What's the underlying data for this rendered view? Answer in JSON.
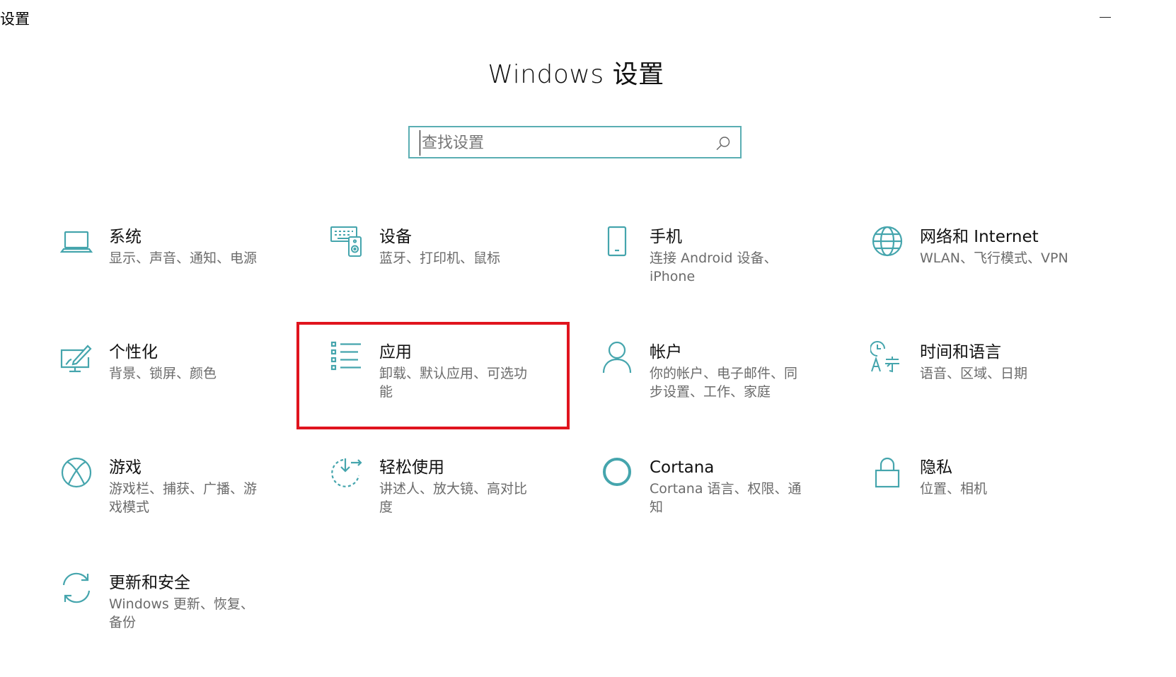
{
  "window": {
    "title": "设置",
    "minimize_label": "—"
  },
  "page": {
    "title": "Windows 设置"
  },
  "search": {
    "placeholder": "查找设置",
    "value": ""
  },
  "colors": {
    "accent": "#45a5ad",
    "highlight_frame": "#e0141e",
    "title_text": "#111111",
    "desc_text": "#6b6b6b"
  },
  "tiles": [
    {
      "title": "系统",
      "desc_lines": [
        "显示、声音、通知、电源"
      ],
      "icon": "laptop-icon"
    },
    {
      "title": "设备",
      "desc_lines": [
        "蓝牙、打印机、鼠标"
      ],
      "icon": "devices-icon"
    },
    {
      "title": "手机",
      "desc_lines": [
        "连接 Android 设备、",
        "iPhone"
      ],
      "icon": "phone-icon"
    },
    {
      "title": "网络和 Internet",
      "desc_lines": [
        "WLAN、飞行模式、VPN"
      ],
      "icon": "globe-icon"
    },
    {
      "title": "个性化",
      "desc_lines": [
        "背景、锁屏、颜色"
      ],
      "icon": "personalization-icon"
    },
    {
      "title": "应用",
      "desc_lines": [
        "卸载、默认应用、可选功",
        "能"
      ],
      "icon": "apps-list-icon"
    },
    {
      "title": "帐户",
      "desc_lines": [
        "你的帐户、电子邮件、同",
        "步设置、工作、家庭"
      ],
      "icon": "person-icon"
    },
    {
      "title": "时间和语言",
      "desc_lines": [
        "语音、区域、日期"
      ],
      "icon": "time-language-icon"
    },
    {
      "title": "游戏",
      "desc_lines": [
        "游戏栏、捕获、广播、游",
        "戏模式"
      ],
      "icon": "xbox-icon"
    },
    {
      "title": "轻松使用",
      "desc_lines": [
        "讲述人、放大镜、高对比",
        "度"
      ],
      "icon": "ease-of-access-icon"
    },
    {
      "title": "Cortana",
      "desc_lines": [
        "Cortana 语言、权限、通",
        "知"
      ],
      "icon": "cortana-icon"
    },
    {
      "title": "隐私",
      "desc_lines": [
        "位置、相机"
      ],
      "icon": "lock-icon"
    },
    {
      "title": "更新和安全",
      "desc_lines": [
        "Windows 更新、恢复、",
        "备份"
      ],
      "icon": "sync-icon"
    }
  ]
}
